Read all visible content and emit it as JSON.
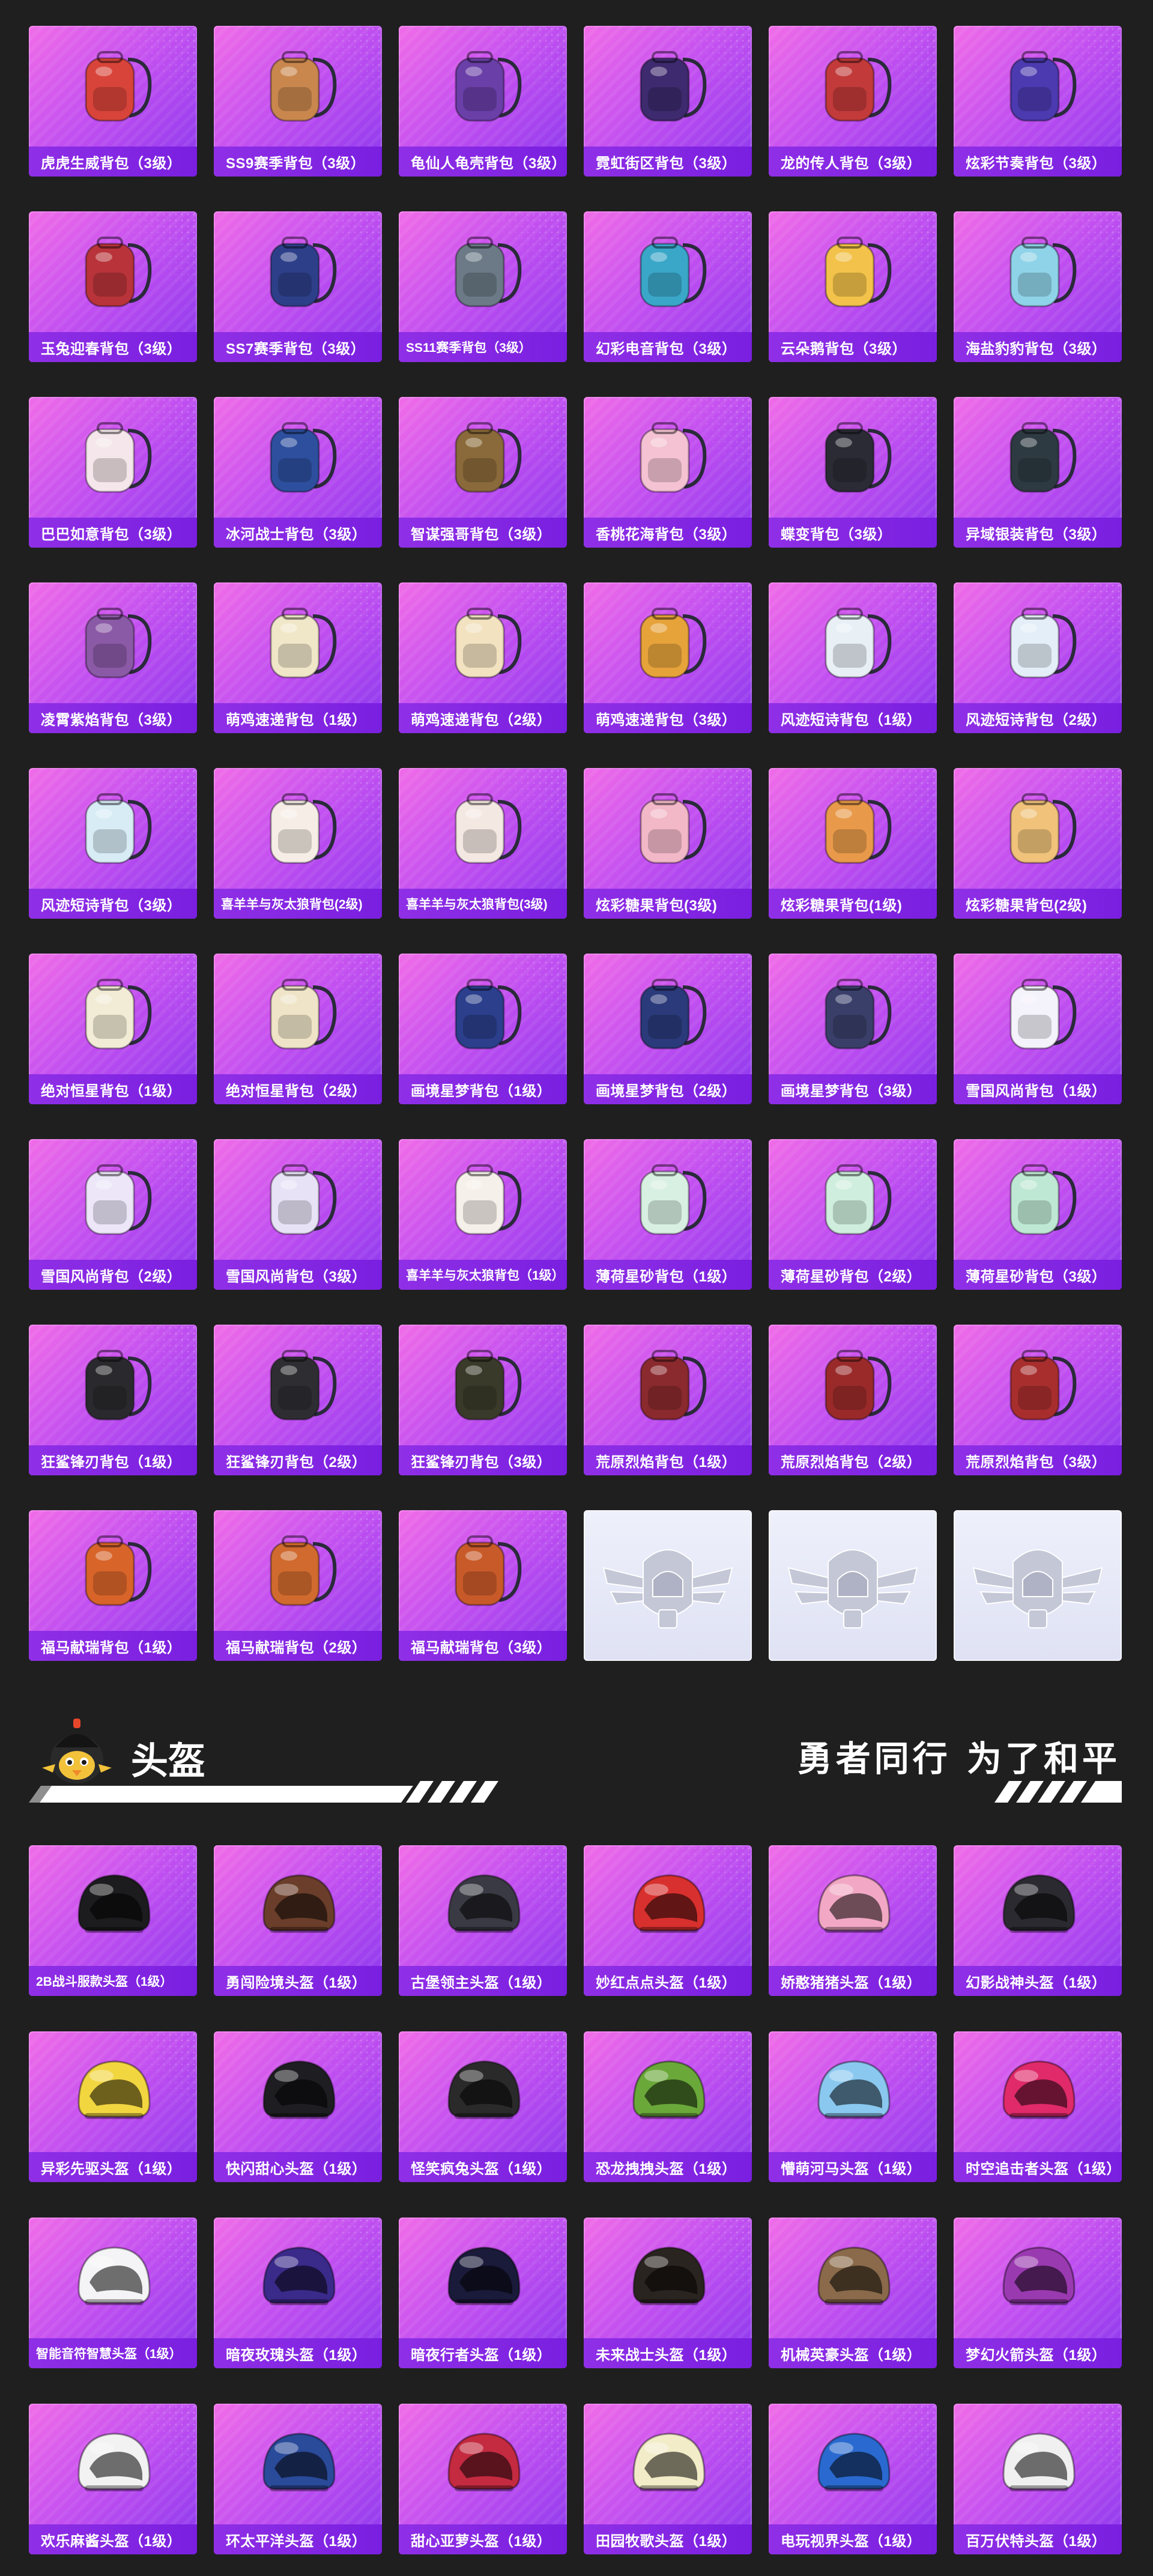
{
  "backpacks": [
    {
      "label": "虎虎生威背包（3级）",
      "icon": "backpack-icon",
      "color": "#d8443a"
    },
    {
      "label": "SS9赛季背包（3级）",
      "icon": "backpack-icon",
      "color": "#c9874e"
    },
    {
      "label": "龟仙人龟壳背包（3级）",
      "icon": "backpack-icon",
      "color": "#6a3fa8"
    },
    {
      "label": "霓虹街区背包（3级）",
      "icon": "backpack-icon",
      "color": "#3e2a6e"
    },
    {
      "label": "龙的传人背包（3级）",
      "icon": "backpack-icon",
      "color": "#c23a3a"
    },
    {
      "label": "炫彩节奏背包（3级）",
      "icon": "backpack-icon",
      "color": "#4c3ab0"
    },
    {
      "label": "玉兔迎春背包（3级）",
      "icon": "backpack-icon",
      "color": "#b8343a"
    },
    {
      "label": "SS7赛季背包（3级）",
      "icon": "backpack-icon",
      "color": "#2e3f8a"
    },
    {
      "label": "SS11赛季背包（3级）",
      "icon": "backpack-icon",
      "color": "#6b7a86"
    },
    {
      "label": "幻彩电音背包（3级）",
      "icon": "backpack-icon",
      "color": "#3aa7c9"
    },
    {
      "label": "云朵鹅背包（3级）",
      "icon": "backpack-icon",
      "color": "#f2c24a"
    },
    {
      "label": "海盐豹豹背包（3级）",
      "icon": "backpack-icon",
      "color": "#8fd3e8"
    },
    {
      "label": "巴巴如意背包（3级）",
      "icon": "backpack-icon",
      "color": "#f4e6ea"
    },
    {
      "label": "冰河战士背包（3级）",
      "icon": "backpack-icon",
      "color": "#2d4f9e"
    },
    {
      "label": "智谋强哥背包（3级）",
      "icon": "backpack-icon",
      "color": "#8a6a3a"
    },
    {
      "label": "香桃花海背包（3级）",
      "icon": "backpack-icon",
      "color": "#f4c2d2"
    },
    {
      "label": "蝶变背包（3级）",
      "icon": "backpack-icon",
      "color": "#2b2b36"
    },
    {
      "label": "异域银装背包（3级）",
      "icon": "backpack-icon",
      "color": "#2e3a42"
    },
    {
      "label": "凌霄紫焰背包（3级）",
      "icon": "backpack-icon",
      "color": "#8b5aa6"
    },
    {
      "label": "萌鸡速递背包（1级）",
      "icon": "backpack-icon",
      "color": "#f0e6c8"
    },
    {
      "label": "萌鸡速递背包（2级）",
      "icon": "backpack-icon",
      "color": "#f2e2c0"
    },
    {
      "label": "萌鸡速递背包（3级）",
      "icon": "backpack-icon",
      "color": "#e6a33a"
    },
    {
      "label": "风迹短诗背包（1级）",
      "icon": "backpack-icon",
      "color": "#e8f0f6"
    },
    {
      "label": "风迹短诗背包（2级）",
      "icon": "backpack-icon",
      "color": "#e4eef8"
    },
    {
      "label": "风迹短诗背包（3级）",
      "icon": "backpack-icon",
      "color": "#d8ecf6"
    },
    {
      "label": "喜羊羊与灰太狼背包(2级)",
      "icon": "backpack-icon",
      "color": "#f6eee6"
    },
    {
      "label": "喜羊羊与灰太狼背包(3级)",
      "icon": "backpack-icon",
      "color": "#f4e8e2"
    },
    {
      "label": "炫彩糖果背包(3级)",
      "icon": "backpack-icon",
      "color": "#f2b8c8"
    },
    {
      "label": "炫彩糖果背包(1级)",
      "icon": "backpack-icon",
      "color": "#e89a4a"
    },
    {
      "label": "炫彩糖果背包(2级)",
      "icon": "backpack-icon",
      "color": "#f0c27a"
    },
    {
      "label": "绝对恒星背包（1级）",
      "icon": "backpack-icon",
      "color": "#f2ecd6"
    },
    {
      "label": "绝对恒星背包（2级）",
      "icon": "backpack-icon",
      "color": "#f0e4c8"
    },
    {
      "label": "画境星梦背包（1级）",
      "icon": "backpack-icon",
      "color": "#2b3f8c"
    },
    {
      "label": "画境星梦背包（2级）",
      "icon": "backpack-icon",
      "color": "#2a3a7a"
    },
    {
      "label": "画境星梦背包（3级）",
      "icon": "backpack-icon",
      "color": "#3a3f6a"
    },
    {
      "label": "雪国风尚背包（1级）",
      "icon": "backpack-icon",
      "color": "#f4f2fa"
    },
    {
      "label": "雪国风尚背包（2级）",
      "icon": "backpack-icon",
      "color": "#ece6f8"
    },
    {
      "label": "雪国风尚背包（3级）",
      "icon": "backpack-icon",
      "color": "#e8e2f6"
    },
    {
      "label": "喜羊羊与灰太狼背包（1级）",
      "icon": "backpack-icon",
      "color": "#f6f0ea"
    },
    {
      "label": "薄荷星砂背包（1级）",
      "icon": "backpack-icon",
      "color": "#d8f0e2"
    },
    {
      "label": "薄荷星砂背包（2级）",
      "icon": "backpack-icon",
      "color": "#cfeedd"
    },
    {
      "label": "薄荷星砂背包（3级）",
      "icon": "backpack-icon",
      "color": "#bfe8d4"
    },
    {
      "label": "狂鲨锋刃背包（1级）",
      "icon": "backpack-icon",
      "color": "#2a2a2e"
    },
    {
      "label": "狂鲨锋刃背包（2级）",
      "icon": "backpack-icon",
      "color": "#2e2e32"
    },
    {
      "label": "狂鲨锋刃背包（3级）",
      "icon": "backpack-icon",
      "color": "#3a3a2a"
    },
    {
      "label": "荒原烈焰背包（1级）",
      "icon": "backpack-icon",
      "color": "#8a2a2e"
    },
    {
      "label": "荒原烈焰背包（2级）",
      "icon": "backpack-icon",
      "color": "#9a2a2a"
    },
    {
      "label": "荒原烈焰背包（3级）",
      "icon": "backpack-icon",
      "color": "#a82e2e"
    },
    {
      "label": "福马献瑞背包（1级）",
      "icon": "backpack-icon",
      "color": "#d8642a"
    },
    {
      "label": "福马献瑞背包（2级）",
      "icon": "backpack-icon",
      "color": "#d06a2e"
    },
    {
      "label": "福马献瑞背包（3级）",
      "icon": "backpack-icon",
      "color": "#c85a2a"
    },
    {
      "label": "",
      "icon": "emblem-placeholder-icon",
      "placeholder": true
    },
    {
      "label": "",
      "icon": "emblem-placeholder-icon",
      "placeholder": true
    },
    {
      "label": "",
      "icon": "emblem-placeholder-icon",
      "placeholder": true
    }
  ],
  "section": {
    "title": "头盔",
    "slogan": "勇者同行 为了和平"
  },
  "helmets": [
    {
      "label": "2B战斗服款头盔（1级）",
      "icon": "helmet-icon",
      "color": "#1c1c1e"
    },
    {
      "label": "勇闯险境头盔（1级）",
      "icon": "helmet-icon",
      "color": "#6a3e2a"
    },
    {
      "label": "古堡领主头盔（1级）",
      "icon": "helmet-icon",
      "color": "#3a3a44"
    },
    {
      "label": "妙红点点头盔（1级）",
      "icon": "helmet-icon",
      "color": "#d8302e"
    },
    {
      "label": "娇憨猪猪头盔（1级）",
      "icon": "helmet-icon",
      "color": "#f2a8c4"
    },
    {
      "label": "幻影战神头盔（1级）",
      "icon": "helmet-icon",
      "color": "#2a2a30"
    },
    {
      "label": "异彩先驱头盔（1级）",
      "icon": "helmet-icon",
      "color": "#f2d640"
    },
    {
      "label": "快闪甜心头盔（1级）",
      "icon": "helmet-icon",
      "color": "#1e1e22"
    },
    {
      "label": "怪笑疯兔头盔（1级）",
      "icon": "helmet-icon",
      "color": "#2a2a2a"
    },
    {
      "label": "恐龙拽拽头盔（1级）",
      "icon": "helmet-icon",
      "color": "#6aa83a"
    },
    {
      "label": "懵萌河马头盔（1级）",
      "icon": "helmet-icon",
      "color": "#8ac8f0"
    },
    {
      "label": "时空追击者头盔（1级）",
      "icon": "helmet-icon",
      "color": "#e02a6a"
    },
    {
      "label": "智能音符智慧头盔（1级）",
      "icon": "helmet-icon",
      "color": "#f4f4f6"
    },
    {
      "label": "暗夜玫瑰头盔（1级）",
      "icon": "helmet-icon",
      "color": "#3a2a8a"
    },
    {
      "label": "暗夜行者头盔（1级）",
      "icon": "helmet-icon",
      "color": "#1a1a3a"
    },
    {
      "label": "未来战士头盔（1级）",
      "icon": "helmet-icon",
      "color": "#2a2420"
    },
    {
      "label": "机械英豪头盔（1级）",
      "icon": "helmet-icon",
      "color": "#8a6a4a"
    },
    {
      "label": "梦幻火箭头盔（1级）",
      "icon": "helmet-icon",
      "color": "#9a3ab0"
    },
    {
      "label": "欢乐麻酱头盔（1级）",
      "icon": "helmet-icon",
      "color": "#f2f2f2"
    },
    {
      "label": "环太平洋头盔（1级）",
      "icon": "helmet-icon",
      "color": "#2a4a9a"
    },
    {
      "label": "甜心亚萝头盔（1级）",
      "icon": "helmet-icon",
      "color": "#c42a40"
    },
    {
      "label": "田园牧歌头盔（1级）",
      "icon": "helmet-icon",
      "color": "#f2ecc8"
    },
    {
      "label": "电玩视界头盔（1级）",
      "icon": "helmet-icon",
      "color": "#2a6ad0"
    },
    {
      "label": "百万伏特头盔（1级）",
      "icon": "helmet-icon",
      "color": "#f0f0f0"
    }
  ]
}
